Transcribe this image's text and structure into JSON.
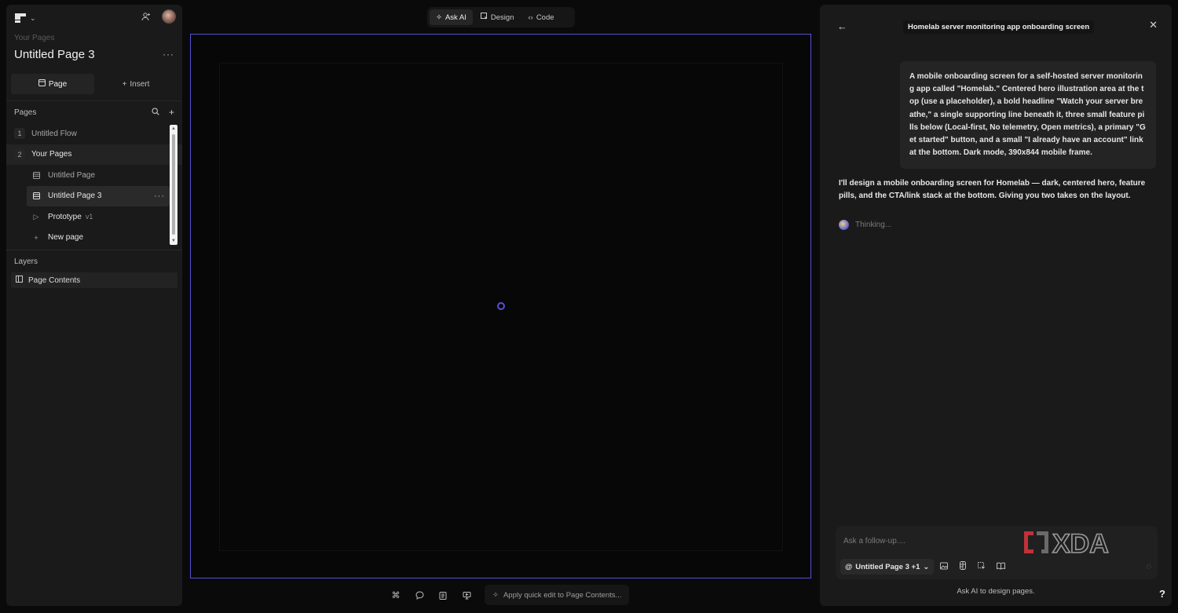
{
  "sidebar": {
    "breadcrumb": "Your Pages",
    "page_title": "Untitled Page 3",
    "more_label": "···",
    "mode_tabs": [
      {
        "label": "Page",
        "icon": "page-icon",
        "active": true
      },
      {
        "label": "Insert",
        "icon": "plus-icon",
        "active": false
      }
    ],
    "pages_header": "Pages",
    "pages": [
      {
        "num": "1",
        "label": "Untitled Flow"
      },
      {
        "num": "2",
        "label": "Your Pages"
      }
    ],
    "subpages": [
      {
        "label": "Untitled Page",
        "icon": "page-icon"
      },
      {
        "label": "Untitled Page 3",
        "icon": "page-icon",
        "active": true
      },
      {
        "label": "Prototype",
        "tag": "v1",
        "icon": "play-icon"
      },
      {
        "label": "New page",
        "icon": "plus-icon"
      }
    ],
    "layers_header": "Layers",
    "layers": [
      {
        "label": "Page Contents",
        "icon": "layout-icon"
      }
    ]
  },
  "top_toolbar": {
    "items": [
      {
        "label": "Ask AI",
        "icon": "sparkle-icon",
        "active": true
      },
      {
        "label": "Design",
        "icon": "cursor-icon",
        "active": false
      },
      {
        "label": "Code",
        "icon": "code-icon",
        "active": false
      }
    ]
  },
  "bottom_toolbar": {
    "quick_edit_label": "Apply quick edit to Page Contents..."
  },
  "ai_panel": {
    "title": "Homelab server monitoring app onboarding screen",
    "user_message": "A mobile onboarding screen for a self-hosted server monitoring app called \"Homelab.\" Centered hero illustration area at the top (use a placeholder), a bold headline \"Watch your server breathe,\" a single supporting line beneath it, three small feature pills below (Local-first, No telemetry, Open metrics), a primary \"Get started\" button, and a small \"I already have an account\" link at the bottom. Dark mode, 390x844 mobile frame.",
    "ai_message": "I'll design a mobile onboarding screen for Homelab — dark, centered hero, feature pills, and the CTA/link stack at the bottom. Giving you two takes on the layout.",
    "thinking_label": "Thinking...",
    "composer_placeholder": "Ask a follow-up....",
    "context_chip": "Untitled Page 3 +1",
    "context_prefix": "@",
    "footer": "Ask AI to design pages.",
    "watermark": "XDA"
  },
  "help_label": "?",
  "colors": {
    "accent": "#5a4fd6",
    "background": "#0a0a0a",
    "panel": "#1a1a1a"
  }
}
